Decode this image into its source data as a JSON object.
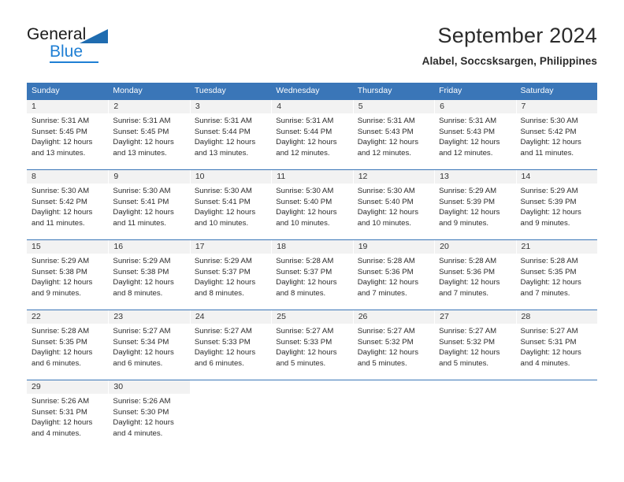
{
  "brand": {
    "name_part1": "General",
    "name_part2": "Blue",
    "triangle_color": "#1f6cb0",
    "blue_color": "#1f7fd4"
  },
  "header": {
    "title": "September 2024",
    "subtitle": "Alabel, Soccsksargen, Philippines"
  },
  "theme": {
    "header_blue": "#3a76b8",
    "daynum_band": "#f2f2f2",
    "text": "#2b2b2b"
  },
  "calendar": {
    "weekdays": [
      "Sunday",
      "Monday",
      "Tuesday",
      "Wednesday",
      "Thursday",
      "Friday",
      "Saturday"
    ],
    "weeks": [
      [
        {
          "day": "1",
          "sunrise": "Sunrise: 5:31 AM",
          "sunset": "Sunset: 5:45 PM",
          "daylight1": "Daylight: 12 hours",
          "daylight2": "and 13 minutes."
        },
        {
          "day": "2",
          "sunrise": "Sunrise: 5:31 AM",
          "sunset": "Sunset: 5:45 PM",
          "daylight1": "Daylight: 12 hours",
          "daylight2": "and 13 minutes."
        },
        {
          "day": "3",
          "sunrise": "Sunrise: 5:31 AM",
          "sunset": "Sunset: 5:44 PM",
          "daylight1": "Daylight: 12 hours",
          "daylight2": "and 13 minutes."
        },
        {
          "day": "4",
          "sunrise": "Sunrise: 5:31 AM",
          "sunset": "Sunset: 5:44 PM",
          "daylight1": "Daylight: 12 hours",
          "daylight2": "and 12 minutes."
        },
        {
          "day": "5",
          "sunrise": "Sunrise: 5:31 AM",
          "sunset": "Sunset: 5:43 PM",
          "daylight1": "Daylight: 12 hours",
          "daylight2": "and 12 minutes."
        },
        {
          "day": "6",
          "sunrise": "Sunrise: 5:31 AM",
          "sunset": "Sunset: 5:43 PM",
          "daylight1": "Daylight: 12 hours",
          "daylight2": "and 12 minutes."
        },
        {
          "day": "7",
          "sunrise": "Sunrise: 5:30 AM",
          "sunset": "Sunset: 5:42 PM",
          "daylight1": "Daylight: 12 hours",
          "daylight2": "and 11 minutes."
        }
      ],
      [
        {
          "day": "8",
          "sunrise": "Sunrise: 5:30 AM",
          "sunset": "Sunset: 5:42 PM",
          "daylight1": "Daylight: 12 hours",
          "daylight2": "and 11 minutes."
        },
        {
          "day": "9",
          "sunrise": "Sunrise: 5:30 AM",
          "sunset": "Sunset: 5:41 PM",
          "daylight1": "Daylight: 12 hours",
          "daylight2": "and 11 minutes."
        },
        {
          "day": "10",
          "sunrise": "Sunrise: 5:30 AM",
          "sunset": "Sunset: 5:41 PM",
          "daylight1": "Daylight: 12 hours",
          "daylight2": "and 10 minutes."
        },
        {
          "day": "11",
          "sunrise": "Sunrise: 5:30 AM",
          "sunset": "Sunset: 5:40 PM",
          "daylight1": "Daylight: 12 hours",
          "daylight2": "and 10 minutes."
        },
        {
          "day": "12",
          "sunrise": "Sunrise: 5:30 AM",
          "sunset": "Sunset: 5:40 PM",
          "daylight1": "Daylight: 12 hours",
          "daylight2": "and 10 minutes."
        },
        {
          "day": "13",
          "sunrise": "Sunrise: 5:29 AM",
          "sunset": "Sunset: 5:39 PM",
          "daylight1": "Daylight: 12 hours",
          "daylight2": "and 9 minutes."
        },
        {
          "day": "14",
          "sunrise": "Sunrise: 5:29 AM",
          "sunset": "Sunset: 5:39 PM",
          "daylight1": "Daylight: 12 hours",
          "daylight2": "and 9 minutes."
        }
      ],
      [
        {
          "day": "15",
          "sunrise": "Sunrise: 5:29 AM",
          "sunset": "Sunset: 5:38 PM",
          "daylight1": "Daylight: 12 hours",
          "daylight2": "and 9 minutes."
        },
        {
          "day": "16",
          "sunrise": "Sunrise: 5:29 AM",
          "sunset": "Sunset: 5:38 PM",
          "daylight1": "Daylight: 12 hours",
          "daylight2": "and 8 minutes."
        },
        {
          "day": "17",
          "sunrise": "Sunrise: 5:29 AM",
          "sunset": "Sunset: 5:37 PM",
          "daylight1": "Daylight: 12 hours",
          "daylight2": "and 8 minutes."
        },
        {
          "day": "18",
          "sunrise": "Sunrise: 5:28 AM",
          "sunset": "Sunset: 5:37 PM",
          "daylight1": "Daylight: 12 hours",
          "daylight2": "and 8 minutes."
        },
        {
          "day": "19",
          "sunrise": "Sunrise: 5:28 AM",
          "sunset": "Sunset: 5:36 PM",
          "daylight1": "Daylight: 12 hours",
          "daylight2": "and 7 minutes."
        },
        {
          "day": "20",
          "sunrise": "Sunrise: 5:28 AM",
          "sunset": "Sunset: 5:36 PM",
          "daylight1": "Daylight: 12 hours",
          "daylight2": "and 7 minutes."
        },
        {
          "day": "21",
          "sunrise": "Sunrise: 5:28 AM",
          "sunset": "Sunset: 5:35 PM",
          "daylight1": "Daylight: 12 hours",
          "daylight2": "and 7 minutes."
        }
      ],
      [
        {
          "day": "22",
          "sunrise": "Sunrise: 5:28 AM",
          "sunset": "Sunset: 5:35 PM",
          "daylight1": "Daylight: 12 hours",
          "daylight2": "and 6 minutes."
        },
        {
          "day": "23",
          "sunrise": "Sunrise: 5:27 AM",
          "sunset": "Sunset: 5:34 PM",
          "daylight1": "Daylight: 12 hours",
          "daylight2": "and 6 minutes."
        },
        {
          "day": "24",
          "sunrise": "Sunrise: 5:27 AM",
          "sunset": "Sunset: 5:33 PM",
          "daylight1": "Daylight: 12 hours",
          "daylight2": "and 6 minutes."
        },
        {
          "day": "25",
          "sunrise": "Sunrise: 5:27 AM",
          "sunset": "Sunset: 5:33 PM",
          "daylight1": "Daylight: 12 hours",
          "daylight2": "and 5 minutes."
        },
        {
          "day": "26",
          "sunrise": "Sunrise: 5:27 AM",
          "sunset": "Sunset: 5:32 PM",
          "daylight1": "Daylight: 12 hours",
          "daylight2": "and 5 minutes."
        },
        {
          "day": "27",
          "sunrise": "Sunrise: 5:27 AM",
          "sunset": "Sunset: 5:32 PM",
          "daylight1": "Daylight: 12 hours",
          "daylight2": "and 5 minutes."
        },
        {
          "day": "28",
          "sunrise": "Sunrise: 5:27 AM",
          "sunset": "Sunset: 5:31 PM",
          "daylight1": "Daylight: 12 hours",
          "daylight2": "and 4 minutes."
        }
      ],
      [
        {
          "day": "29",
          "sunrise": "Sunrise: 5:26 AM",
          "sunset": "Sunset: 5:31 PM",
          "daylight1": "Daylight: 12 hours",
          "daylight2": "and 4 minutes."
        },
        {
          "day": "30",
          "sunrise": "Sunrise: 5:26 AM",
          "sunset": "Sunset: 5:30 PM",
          "daylight1": "Daylight: 12 hours",
          "daylight2": "and 4 minutes."
        },
        {
          "day": "",
          "sunrise": "",
          "sunset": "",
          "daylight1": "",
          "daylight2": ""
        },
        {
          "day": "",
          "sunrise": "",
          "sunset": "",
          "daylight1": "",
          "daylight2": ""
        },
        {
          "day": "",
          "sunrise": "",
          "sunset": "",
          "daylight1": "",
          "daylight2": ""
        },
        {
          "day": "",
          "sunrise": "",
          "sunset": "",
          "daylight1": "",
          "daylight2": ""
        },
        {
          "day": "",
          "sunrise": "",
          "sunset": "",
          "daylight1": "",
          "daylight2": ""
        }
      ]
    ]
  }
}
